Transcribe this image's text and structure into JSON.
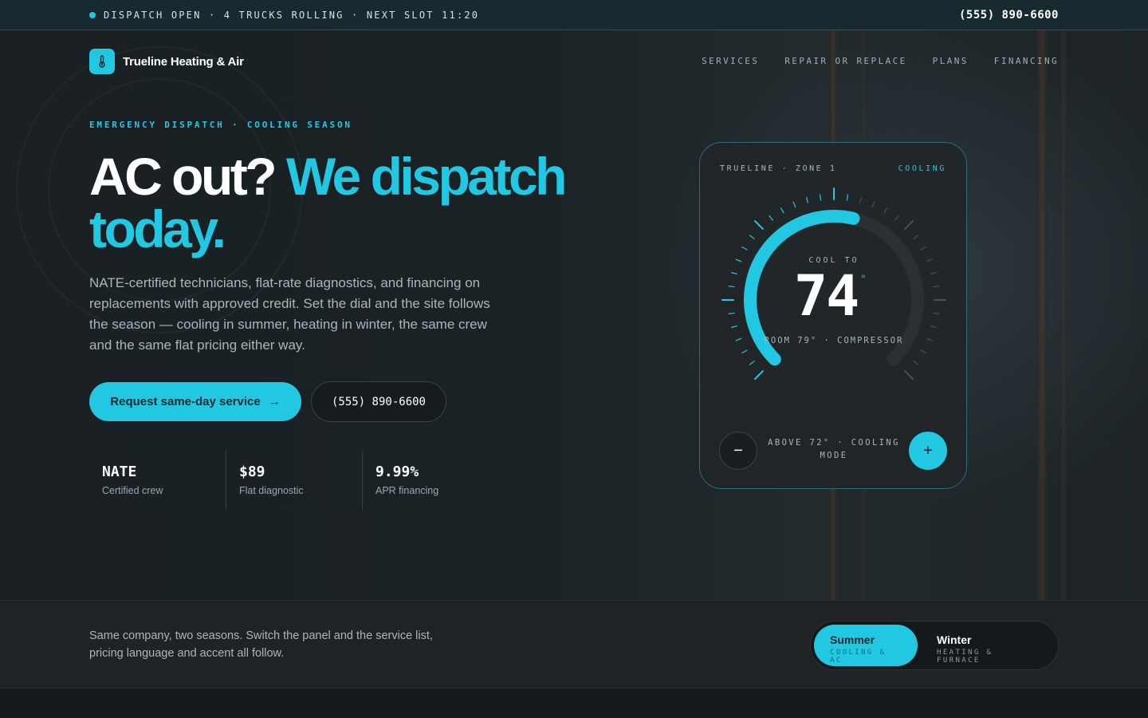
{
  "topbar": {
    "status_text": "DISPATCH OPEN · 4 TRUCKS ROLLING · NEXT SLOT 11:20",
    "phone": "(555) 890-6600"
  },
  "brand": {
    "name": "Trueline Heating & Air",
    "logo_icon": "thermometer-icon"
  },
  "nav": {
    "items": [
      {
        "label": "SERVICES"
      },
      {
        "label": "REPAIR OR REPLACE"
      },
      {
        "label": "PLANS"
      },
      {
        "label": "FINANCING"
      }
    ]
  },
  "hero": {
    "eyebrow": "EMERGENCY DISPATCH · COOLING SEASON",
    "headline_plain": "AC out? ",
    "headline_accent": "We dispatch today.",
    "lede": "NATE-certified technicians, flat-rate diagnostics, and financing on replacements with approved credit. Set the dial and the site follows the season — cooling in summer, heating in winter, the same crew and the same flat pricing either way.",
    "primary_cta": "Request same-day service",
    "primary_cta_icon": "arrow-right-icon",
    "secondary_cta": "(555) 890-6600",
    "stats": [
      {
        "value": "NATE",
        "label": "Certified crew"
      },
      {
        "value": "$89",
        "label": "Flat diagnostic"
      },
      {
        "value": "9.99%",
        "label": "APR financing"
      }
    ]
  },
  "thermostat": {
    "zone": "TRUELINE · ZONE 1",
    "mode": "COOLING",
    "setpoint_label": "COOL TO",
    "setpoint": "74",
    "degree": "°",
    "room_status": "ROOM 79° · COMPRESSOR",
    "note": "ABOVE 72° · COOLING MODE",
    "minus_label": "−",
    "plus_label": "+",
    "dial_fill_fraction": 0.55,
    "accent": "#22c8e2"
  },
  "season": {
    "text": "Same company, two seasons. Switch the panel and the service list, pricing language and accent all follow.",
    "options": [
      {
        "title": "Summer",
        "subtitle": "COOLING & AC",
        "active": true
      },
      {
        "title": "Winter",
        "subtitle": "HEATING & FURNACE",
        "active": false
      }
    ]
  },
  "colors": {
    "accent": "#22c8e2",
    "background": "#15191c",
    "topbar": "#162a30"
  }
}
